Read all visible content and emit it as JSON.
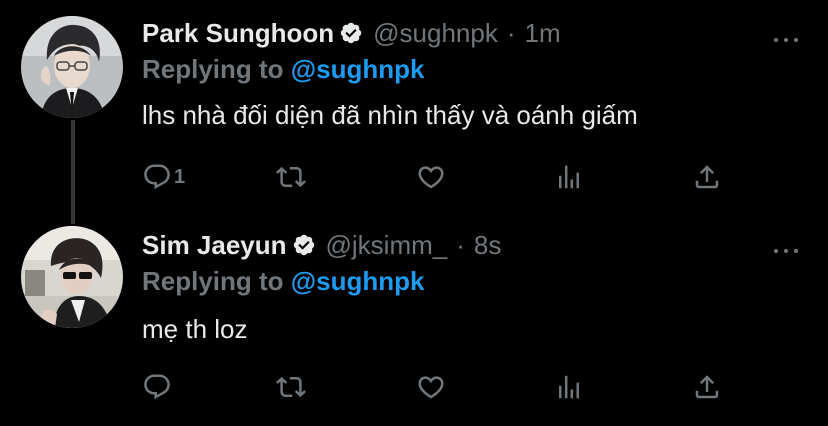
{
  "colors": {
    "background": "#000000",
    "primary_text": "#e7e9ea",
    "secondary_text": "#71767b",
    "link": "#1d9bf0",
    "thread_line": "#333639"
  },
  "tweets": [
    {
      "display_name": "Park Sunghoon",
      "verified_icon": "verified-badge-icon",
      "handle": "@sughnpk",
      "separator": "·",
      "time": "1m",
      "replying_prefix": "Replying to",
      "replying_handle": "@sughnpk",
      "text": "lhs nhà đối diện đã nhìn thấy và oánh giấm",
      "reply_count": "1"
    },
    {
      "display_name": "Sim Jaeyun",
      "verified_icon": "verified-badge-icon",
      "handle": "@jksimm_",
      "separator": "·",
      "time": "8s",
      "replying_prefix": "Replying to",
      "replying_handle": "@sughnpk",
      "text": "mẹ th loz",
      "reply_count": ""
    }
  ]
}
